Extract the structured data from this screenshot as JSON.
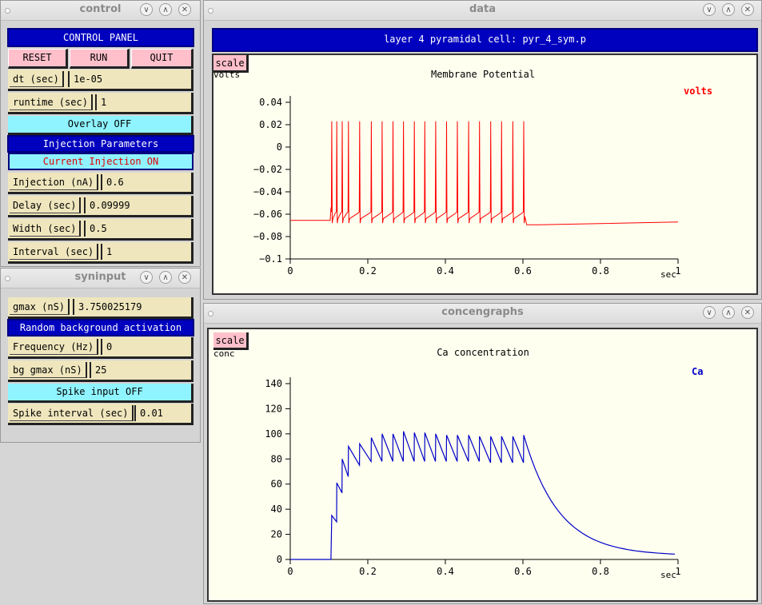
{
  "control": {
    "window_title": "control",
    "header": "CONTROL PANEL",
    "buttons": {
      "reset": "RESET",
      "run": "RUN",
      "quit": "QUIT"
    },
    "dt": {
      "label": "dt (sec)",
      "value": "1e-05"
    },
    "runtime": {
      "label": "runtime (sec)",
      "value": "1"
    },
    "overlay": "Overlay OFF",
    "injection_header": "Injection Parameters",
    "current_injection": "Current Injection ON",
    "injection": {
      "label": "Injection (nA)",
      "value": "0.6"
    },
    "delay": {
      "label": "Delay (sec)",
      "value": "0.09999"
    },
    "width": {
      "label": "Width (sec)",
      "value": "0.5"
    },
    "interval": {
      "label": "Interval (sec)",
      "value": "1"
    }
  },
  "syninput": {
    "window_title": "syninput",
    "gmax": {
      "label": "gmax (nS)",
      "value": "3.750025179"
    },
    "random_header": "Random background activation",
    "frequency": {
      "label": "Frequency (Hz)",
      "value": "0"
    },
    "bg_gmax": {
      "label": "bg gmax (nS)",
      "value": "25"
    },
    "spike_input": "Spike input OFF",
    "spike_interval": {
      "label": "Spike interval (sec)",
      "value": "0.01"
    }
  },
  "data_window": {
    "window_title": "data",
    "header": "layer 4 pyramidal cell: pyr_4_sym.p",
    "scale_label": "scale"
  },
  "conc_window": {
    "window_title": "concengraphs",
    "scale_label": "scale"
  },
  "colors": {
    "navy": "#0000bf",
    "pink": "#ffc0cb",
    "cyan": "#8ff4ff",
    "field": "#efe6bd",
    "plot_bg": "#fffff0",
    "vm_trace": "#ff0000",
    "ca_trace": "#0000c8"
  },
  "chart_data": [
    {
      "type": "line",
      "title": "Membrane Potential",
      "ylabel": "volts",
      "xlabel": "sec",
      "legend": "volts",
      "legend_position": "top-right",
      "xlim": [
        0,
        1
      ],
      "ylim": [
        -0.1,
        0.04
      ],
      "x_ticks": [
        "0",
        "0.2",
        "0.4",
        "0.6",
        "0.8",
        "1"
      ],
      "y_ticks": [
        "0.04",
        "0.02",
        "0",
        "−0.02",
        "−0.04",
        "−0.06",
        "−0.08",
        "−0.1"
      ],
      "spike_times": [
        0.107,
        0.12,
        0.134,
        0.15,
        0.179,
        0.209,
        0.237,
        0.265,
        0.292,
        0.32,
        0.347,
        0.375,
        0.403,
        0.431,
        0.46,
        0.488,
        0.517,
        0.545,
        0.574,
        0.602
      ],
      "spike_peak": 0.023,
      "resting": -0.0655,
      "plateau": -0.058,
      "after_hyperpolarization": -0.0695,
      "final_value": -0.067
    },
    {
      "type": "line",
      "title": "Ca concentration",
      "ylabel": "conc",
      "xlabel": "sec",
      "legend": "Ca",
      "legend_position": "top-right",
      "xlim": [
        0,
        1
      ],
      "ylim": [
        0,
        140
      ],
      "x_ticks": [
        "0",
        "0.2",
        "0.4",
        "0.6",
        "0.8",
        "1"
      ],
      "y_ticks": [
        "140",
        "120",
        "100",
        "80",
        "60",
        "40",
        "20",
        "0"
      ],
      "spike_times": [
        0.107,
        0.12,
        0.134,
        0.15,
        0.179,
        0.209,
        0.237,
        0.265,
        0.292,
        0.32,
        0.347,
        0.375,
        0.403,
        0.431,
        0.46,
        0.488,
        0.517,
        0.545,
        0.574,
        0.602
      ],
      "peaks": [
        35,
        61,
        80,
        90,
        92,
        97,
        100,
        100,
        102,
        101,
        101,
        100,
        99,
        99,
        99,
        98,
        98,
        98,
        98,
        99
      ],
      "troughs": [
        30,
        53,
        66,
        75,
        78,
        78,
        78,
        78,
        78,
        78,
        78,
        78,
        78,
        78,
        78,
        77,
        77,
        77,
        77,
        77
      ],
      "decay_end_value": 3
    }
  ]
}
